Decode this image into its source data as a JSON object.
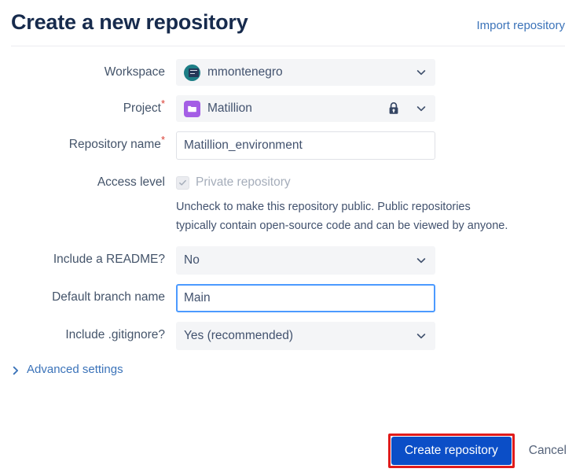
{
  "header": {
    "title": "Create a new repository",
    "import_link": "Import repository"
  },
  "form": {
    "workspace": {
      "label": "Workspace",
      "value": "mmontenegro",
      "avatar_color": "#1d7e86",
      "required": false
    },
    "project": {
      "label": "Project",
      "value": "Matillion",
      "avatar_color": "#a45ee5",
      "required": true,
      "required_marker": "*",
      "lock": "lock-icon"
    },
    "repository_name": {
      "label": "Repository name",
      "value": "Matillion_environment",
      "required": true,
      "required_marker": "*"
    },
    "access_level": {
      "label": "Access level",
      "checkbox_label": "Private repository",
      "checked": true,
      "disabled": true,
      "help_line_1": "Uncheck to make this repository public. Public repositories",
      "help_line_2": "typically contain open-source code and can be viewed by anyone."
    },
    "include_readme": {
      "label": "Include a README?",
      "value": "No"
    },
    "default_branch": {
      "label": "Default branch name",
      "value": "Main",
      "focused": true
    },
    "include_gitignore": {
      "label": "Include .gitignore?",
      "value": "Yes (recommended)"
    }
  },
  "advanced": {
    "label": "Advanced settings",
    "expanded": false,
    "icon": "chevron-right-icon"
  },
  "footer": {
    "create_label": "Create repository",
    "cancel_label": "Cancel",
    "highlight_color": "#e01b1b",
    "primary_color": "#0b4ec7"
  }
}
